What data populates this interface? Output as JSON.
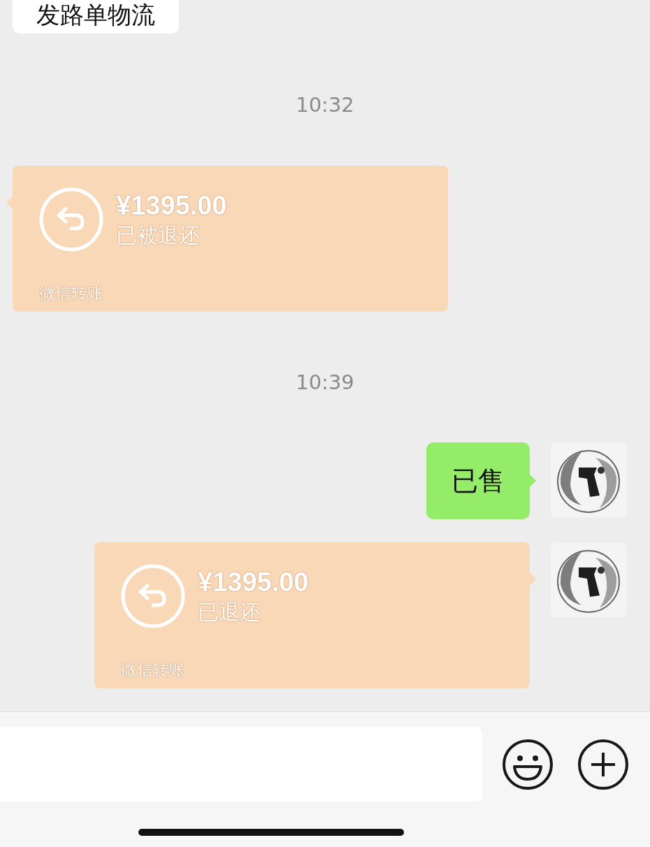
{
  "messages": [
    {
      "kind": "text",
      "outgoing": false,
      "text": "发路单物流"
    },
    {
      "kind": "time",
      "text": "10:32"
    },
    {
      "kind": "transfer",
      "outgoing": false,
      "amount": "¥1395.00",
      "status": "已被退还",
      "label": "微信转账"
    },
    {
      "kind": "time",
      "text": "10:39"
    },
    {
      "kind": "text",
      "outgoing": true,
      "text": "已售"
    },
    {
      "kind": "transfer",
      "outgoing": true,
      "amount": "¥1395.00",
      "status": "已退还",
      "label": "微信转账"
    }
  ]
}
